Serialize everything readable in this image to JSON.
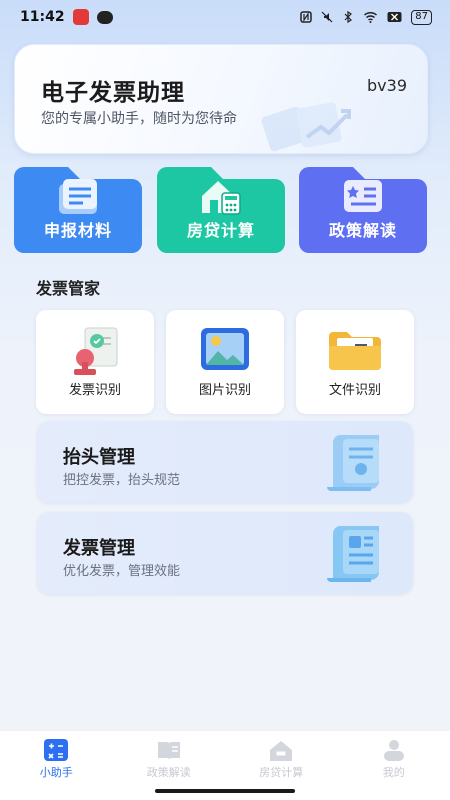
{
  "status_bar": {
    "time": "11:42",
    "battery": "87"
  },
  "header": {
    "title": "电子发票助理",
    "subtitle": "您的专属小助手，随时为您待命",
    "version": "bv39"
  },
  "quick_tiles": [
    {
      "label": "申报材料",
      "color": "#3d8af2",
      "icon": "document-stack-icon"
    },
    {
      "label": "房贷计算",
      "color": "#1dc7a3",
      "icon": "house-calculator-icon"
    },
    {
      "label": "政策解读",
      "color": "#5f6ff2",
      "icon": "policy-book-icon"
    }
  ],
  "section": {
    "title": "发票管家"
  },
  "tools": [
    {
      "label": "发票识别",
      "icon": "invoice-stamp-icon"
    },
    {
      "label": "图片识别",
      "icon": "picture-icon"
    },
    {
      "label": "文件识别",
      "icon": "folder-icon"
    }
  ],
  "features": [
    {
      "title": "抬头管理",
      "subtitle": "把控发票，抬头规范",
      "icon": "scroll-document-icon"
    },
    {
      "title": "发票管理",
      "subtitle": "优化发票，管理效能",
      "icon": "scroll-document-icon"
    }
  ],
  "bottom_nav": [
    {
      "label": "小助手",
      "active": true,
      "icon": "calculator-icon"
    },
    {
      "label": "政策解读",
      "active": false,
      "icon": "book-icon"
    },
    {
      "label": "房贷计算",
      "active": false,
      "icon": "house-icon"
    },
    {
      "label": "我的",
      "active": false,
      "icon": "user-icon"
    }
  ],
  "colors": {
    "accent": "#2c6ff0",
    "inactive": "#c6c9cf"
  }
}
